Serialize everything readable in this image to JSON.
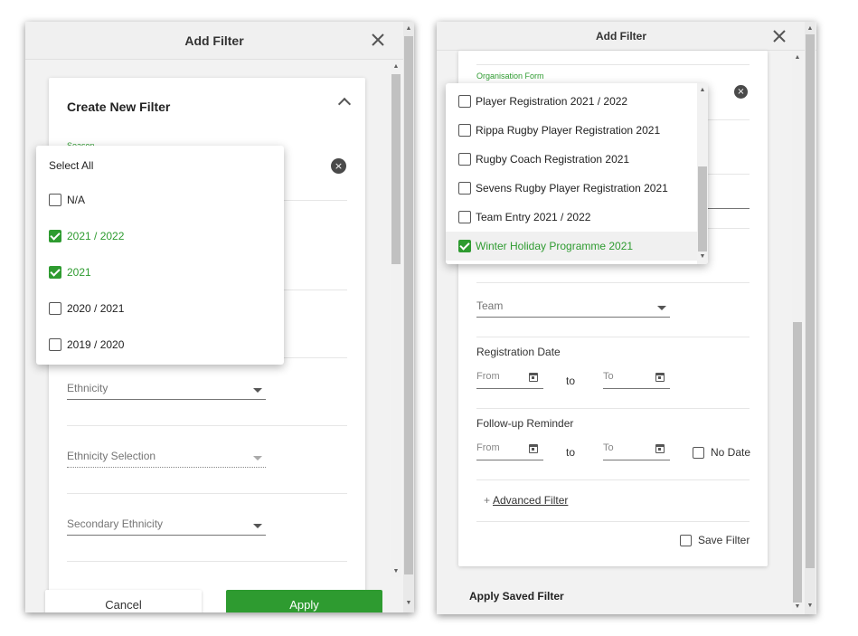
{
  "left": {
    "title": "Add Filter",
    "card_title": "Create New Filter",
    "season_label": "Season",
    "dropdown": {
      "select_all": "Select All",
      "options": [
        {
          "label": "N/A",
          "checked": false
        },
        {
          "label": "2021 / 2022",
          "checked": true
        },
        {
          "label": "2021",
          "checked": true
        },
        {
          "label": "2020 / 2021",
          "checked": false
        },
        {
          "label": "2019 / 2020",
          "checked": false
        }
      ]
    },
    "fields": {
      "ethnicity": "Ethnicity",
      "ethnicity_selection": "Ethnicity Selection",
      "secondary_ethnicity": "Secondary Ethnicity"
    },
    "buttons": {
      "cancel": "Cancel",
      "apply": "Apply"
    }
  },
  "right": {
    "title": "Add Filter",
    "org_form_label": "Organisation Form",
    "dropdown": {
      "options": [
        {
          "label": "Player Registration 2021 / 2022",
          "checked": false
        },
        {
          "label": "Rippa Rugby Player Registration 2021",
          "checked": false
        },
        {
          "label": "Rugby Coach Registration 2021",
          "checked": false
        },
        {
          "label": "Sevens Rugby Player Registration 2021",
          "checked": false
        },
        {
          "label": "Team Entry 2021 / 2022",
          "checked": false
        },
        {
          "label": "Winter Holiday Programme 2021",
          "checked": true
        }
      ]
    },
    "team_placeholder": "Team",
    "registration_date": {
      "label": "Registration Date",
      "from": "From",
      "to_word": "to",
      "to": "To"
    },
    "followup": {
      "label": "Follow-up Reminder",
      "from": "From",
      "to_word": "to",
      "to": "To",
      "no_date": "No Date"
    },
    "advanced_plus": "+",
    "advanced_filter": "Advanced Filter",
    "save_filter": "Save Filter",
    "apply_saved": "Apply Saved Filter"
  },
  "colors": {
    "accent": "#2e9b30",
    "panel_bg": "#f2f2f2",
    "clear_icon": "#4a4a4a"
  }
}
